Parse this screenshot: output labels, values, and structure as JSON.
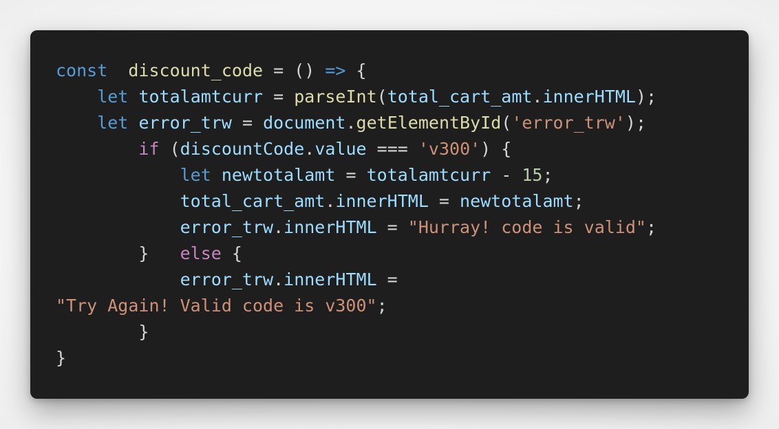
{
  "code_lines": [
    [
      {
        "t": "const",
        "c": "kw"
      },
      {
        "t": "  ",
        "c": "pun"
      },
      {
        "t": "discount_code",
        "c": "fn"
      },
      {
        "t": " = () ",
        "c": "pun"
      },
      {
        "t": "=>",
        "c": "kw"
      },
      {
        "t": " {",
        "c": "pun"
      }
    ],
    [
      {
        "t": "    ",
        "c": "pun"
      },
      {
        "t": "let",
        "c": "kw"
      },
      {
        "t": " ",
        "c": "pun"
      },
      {
        "t": "totalamtcurr",
        "c": "var"
      },
      {
        "t": " = ",
        "c": "pun"
      },
      {
        "t": "parseInt",
        "c": "fn"
      },
      {
        "t": "(",
        "c": "pun"
      },
      {
        "t": "total_cart_amt",
        "c": "var"
      },
      {
        "t": ".",
        "c": "pun"
      },
      {
        "t": "innerHTML",
        "c": "var"
      },
      {
        "t": ");",
        "c": "pun"
      }
    ],
    [
      {
        "t": "    ",
        "c": "pun"
      },
      {
        "t": "let",
        "c": "kw"
      },
      {
        "t": " ",
        "c": "pun"
      },
      {
        "t": "error_trw",
        "c": "var"
      },
      {
        "t": " = ",
        "c": "pun"
      },
      {
        "t": "document",
        "c": "var"
      },
      {
        "t": ".",
        "c": "pun"
      },
      {
        "t": "getElementById",
        "c": "fn"
      },
      {
        "t": "(",
        "c": "pun"
      },
      {
        "t": "'error_trw'",
        "c": "str"
      },
      {
        "t": ");",
        "c": "pun"
      }
    ],
    [
      {
        "t": "        ",
        "c": "pun"
      },
      {
        "t": "if",
        "c": "ctl"
      },
      {
        "t": " (",
        "c": "pun"
      },
      {
        "t": "discountCode",
        "c": "var"
      },
      {
        "t": ".",
        "c": "pun"
      },
      {
        "t": "value",
        "c": "var"
      },
      {
        "t": " === ",
        "c": "pun"
      },
      {
        "t": "'v300'",
        "c": "str"
      },
      {
        "t": ") {",
        "c": "pun"
      }
    ],
    [
      {
        "t": "            ",
        "c": "pun"
      },
      {
        "t": "let",
        "c": "kw"
      },
      {
        "t": " ",
        "c": "pun"
      },
      {
        "t": "newtotalamt",
        "c": "var"
      },
      {
        "t": " = ",
        "c": "pun"
      },
      {
        "t": "totalamtcurr",
        "c": "var"
      },
      {
        "t": " - ",
        "c": "pun"
      },
      {
        "t": "15",
        "c": "num"
      },
      {
        "t": ";",
        "c": "pun"
      }
    ],
    [
      {
        "t": "            ",
        "c": "pun"
      },
      {
        "t": "total_cart_amt",
        "c": "var"
      },
      {
        "t": ".",
        "c": "pun"
      },
      {
        "t": "innerHTML",
        "c": "var"
      },
      {
        "t": " = ",
        "c": "pun"
      },
      {
        "t": "newtotalamt",
        "c": "var"
      },
      {
        "t": ";",
        "c": "pun"
      }
    ],
    [
      {
        "t": "            ",
        "c": "pun"
      },
      {
        "t": "error_trw",
        "c": "var"
      },
      {
        "t": ".",
        "c": "pun"
      },
      {
        "t": "innerHTML",
        "c": "var"
      },
      {
        "t": " = ",
        "c": "pun"
      },
      {
        "t": "\"Hurray! code is valid\"",
        "c": "str"
      },
      {
        "t": ";",
        "c": "pun"
      }
    ],
    [
      {
        "t": "        }   ",
        "c": "pun"
      },
      {
        "t": "else",
        "c": "ctl"
      },
      {
        "t": " {",
        "c": "pun"
      }
    ],
    [
      {
        "t": "            ",
        "c": "pun"
      },
      {
        "t": "error_trw",
        "c": "var"
      },
      {
        "t": ".",
        "c": "pun"
      },
      {
        "t": "innerHTML",
        "c": "var"
      },
      {
        "t": " = ",
        "c": "pun"
      }
    ],
    [
      {
        "t": "\"Try Again! Valid code is v300\"",
        "c": "str"
      },
      {
        "t": ";",
        "c": "pun"
      }
    ],
    [
      {
        "t": "        }",
        "c": "pun"
      }
    ],
    [
      {
        "t": "}",
        "c": "pun"
      }
    ]
  ],
  "colors": {
    "background": "#1e1e1e",
    "keyword": "#569cd6",
    "control": "#c586c0",
    "function": "#dcdcaa",
    "variable": "#9cdcfe",
    "string": "#ce9178",
    "number": "#b5cea8",
    "punctuation": "#d4d4d4"
  }
}
